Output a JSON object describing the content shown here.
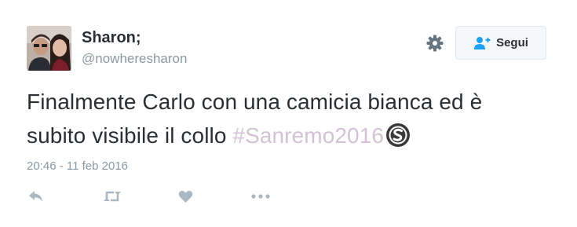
{
  "user": {
    "display_name": "Sharon;",
    "handle": "@nowheresharon"
  },
  "header": {
    "follow_label": "Segui"
  },
  "tweet": {
    "text_before": "Finalmente Carlo con una camicia bianca ed è subito visibile il collo ",
    "hashtag": "#Sanremo2016",
    "timestamp": "20:46 - 11 feb 2016"
  },
  "icons": {
    "settings": "gear-icon",
    "follow": "add-user-icon",
    "hashflag": "sanremo-hashflag-icon",
    "reply": "reply-icon",
    "retweet": "retweet-icon",
    "like": "heart-icon",
    "more": "more-dots-icon"
  },
  "colors": {
    "text": "#292f33",
    "secondary": "#8899a6",
    "link": "#1da1f2",
    "hashtag": "#d3c2d6",
    "action_icons": "#aab8c2"
  }
}
